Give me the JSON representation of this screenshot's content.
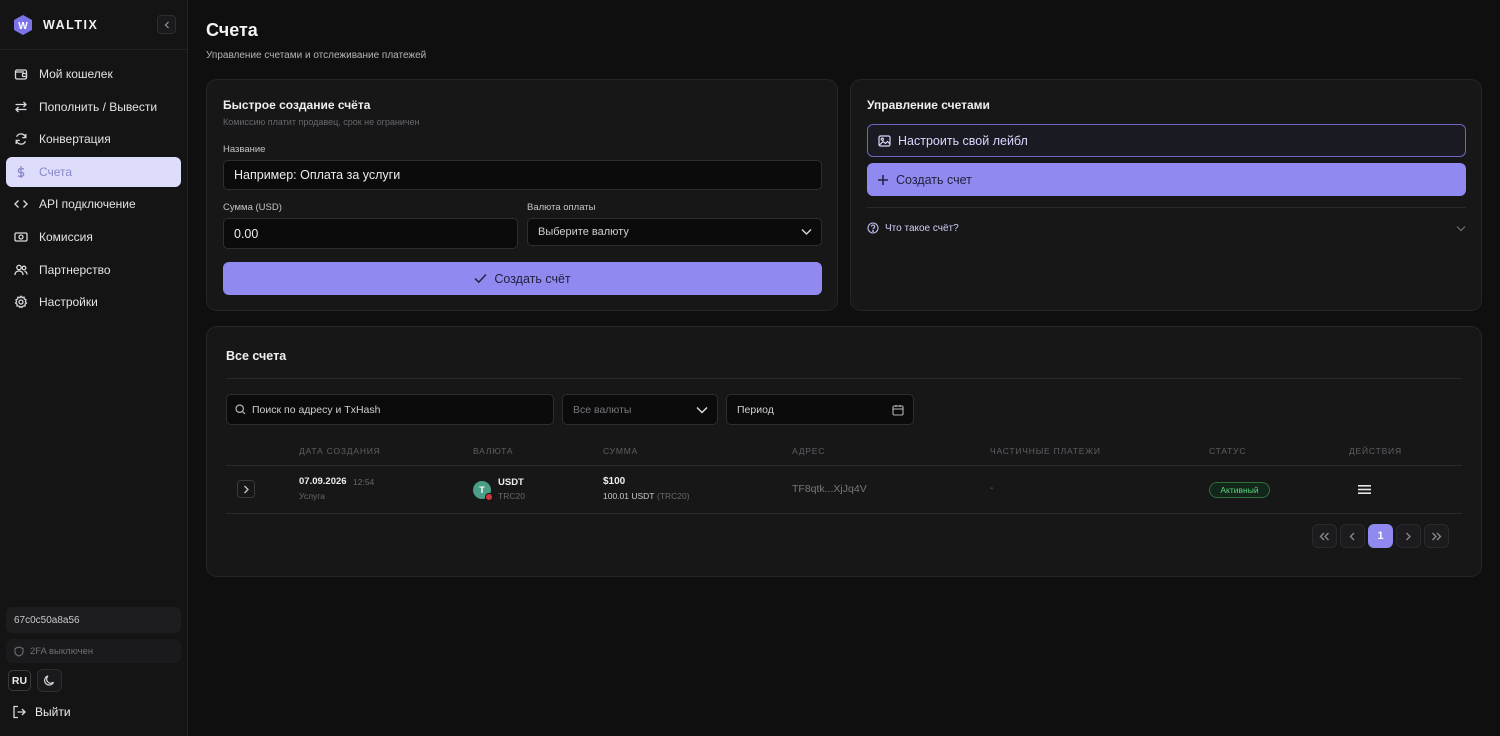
{
  "app": {
    "name": "WALTIX"
  },
  "sidebar": {
    "items": [
      {
        "label": "Мой кошелек",
        "icon": "wallet-icon"
      },
      {
        "label": "Пополнить / Вывести",
        "icon": "arrows-swap-icon"
      },
      {
        "label": "Конвертация",
        "icon": "refresh-icon"
      },
      {
        "label": "Счета",
        "icon": "dollar-icon",
        "active": true
      },
      {
        "label": "API подключение",
        "icon": "code-icon"
      },
      {
        "label": "Комиссия",
        "icon": "banknote-icon"
      },
      {
        "label": "Партнерство",
        "icon": "users-icon"
      },
      {
        "label": "Настройки",
        "icon": "gear-icon"
      }
    ],
    "wallet_id": "67c0c50a8a56",
    "twofa": "2FA выключен",
    "lang": "RU",
    "logout": "Выйти"
  },
  "page": {
    "title": "Счета",
    "subtitle": "Управление счетами и отслеживание платежей"
  },
  "quick_create": {
    "title": "Быстрое создание счёта",
    "subtitle": "Комиссию платит продавец, срок не ограничен",
    "name_label": "Название",
    "name_placeholder": "Например: Оплата за услуги",
    "amount_label": "Сумма (USD)",
    "amount_placeholder": "0.00",
    "currency_label": "Валюта оплаты",
    "currency_value": "Выберите валюту",
    "submit": "Создать счёт"
  },
  "manage": {
    "title": "Управление счетами",
    "label_btn": "Настроить свой лейбл",
    "create_btn": "Создать счет",
    "faq": "Что такое счёт?"
  },
  "all_invoices": {
    "title": "Все счета",
    "search_placeholder": "Поиск по адресу и TxHash",
    "currency_filter": "Все валюты",
    "period_placeholder": "Период",
    "columns": [
      "Дата создания",
      "Валюта",
      "Сумма",
      "Адрес",
      "Частичные платежи",
      "Статус",
      "Действия"
    ],
    "rows": [
      {
        "date": "07.09.2026",
        "time": "12:54",
        "type": "Услуга",
        "currency": "USDT",
        "network": "TRC20",
        "amount": "$100",
        "amount_crypto": "100.01 USDT",
        "amount_network": "(TRC20)",
        "address": "TF8qtk...XjJq4V",
        "partial": "-",
        "status": "Активный"
      }
    ],
    "pagination": {
      "current": "1"
    }
  },
  "colors": {
    "accent": "#8f89f0",
    "active_nav": "#dedcfb",
    "status_active": "#5fd27e"
  }
}
